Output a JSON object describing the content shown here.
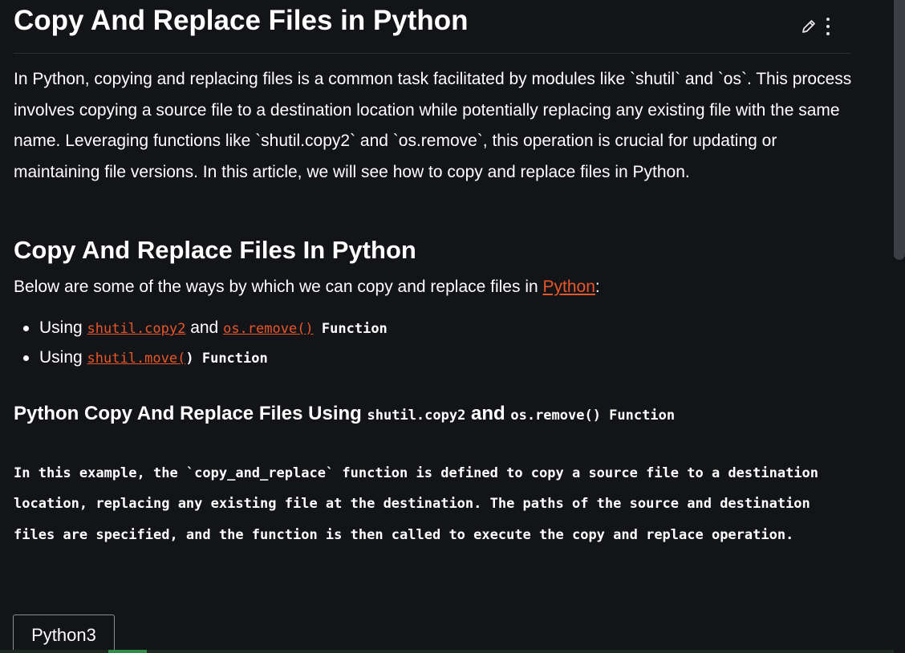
{
  "article": {
    "title": "Copy And Replace Files in Python",
    "actions": [
      {
        "icon": "pencil-icon",
        "name": "edit"
      },
      {
        "icon": "vertical-ellipsis-icon",
        "name": "more-options"
      }
    ],
    "intro": "In Python, copying and replacing files is a common task facilitated by modules like `shutil` and `os`. This process involves copying a source file to a destination location while potentially replacing any existing file with the same name. Leveraging functions like `shutil.copy2` and `os.remove`, this operation is crucial for updating or maintaining file versions. In this article, we will see how to copy and replace files in Python.",
    "section_heading": "Copy And Replace Files In Python",
    "ways_prefix": "Below are some of the ways by which we can copy and replace files in ",
    "ways_link": "Python",
    "ways_suffix": ":",
    "bullets": [
      {
        "prefix": "Using ",
        "link1": "shutil.copy2",
        "middle": " and ",
        "link2": "os.remove()",
        "suffix": " Function"
      },
      {
        "prefix": "Using ",
        "link1": "shutil.move(",
        "code_after": ")",
        "suffix": " Function"
      }
    ],
    "subheading": {
      "prefix": "Python Copy And Replace Files Using ",
      "code1": "shutil.copy2",
      "middle": " and ",
      "code2": "os.remove() Function"
    },
    "example_text": "In this example, the `copy_and_replace` function is defined to copy a source file to a destination location, replacing any existing file at the destination. The paths of the source and destination files are specified, and the function is then called to execute the copy and replace operation.",
    "code_tab_label": "Python3"
  },
  "colors": {
    "background": "#131417",
    "text": "#ffffff",
    "link": "#e8572a",
    "accent_green": "#2f8d46",
    "scrollbar_thumb": "#3b3e44"
  }
}
